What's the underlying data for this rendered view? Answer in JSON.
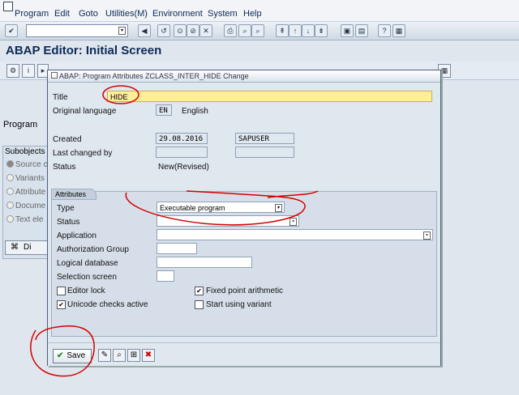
{
  "menubar": {
    "items": [
      "Program",
      "Edit",
      "Goto",
      "Utilities(M)",
      "Environment",
      "System",
      "Help"
    ]
  },
  "app": {
    "title": "ABAP Editor: Initial Screen"
  },
  "background": {
    "program_label": "Program",
    "subobjects_label": "Subobjects",
    "subobject_items": [
      "Source c",
      "Variants",
      "Attribute",
      "Docume",
      "Text ele"
    ],
    "display_button": "Di"
  },
  "dialog": {
    "title": "ABAP: Program Attributes ZCLASS_INTER_HIDE Change",
    "title_label": "Title",
    "title_value": "HIDE",
    "orig_lang_label": "Original language",
    "orig_lang_code": "EN",
    "orig_lang_name": "English",
    "created_label": "Created",
    "created_date": "29.08.2016",
    "created_user": "SAPUSER",
    "last_changed_label": "Last changed by",
    "status_label": "Status",
    "status_value": "New(Revised)",
    "attributes": {
      "group_label": "Attributes",
      "type_label": "Type",
      "type_value": "Executable program",
      "status_label": "Status",
      "application_label": "Application",
      "auth_group_label": "Authorization Group",
      "logical_db_label": "Logical database",
      "selection_screen_label": "Selection screen",
      "editor_lock_label": "Editor lock",
      "editor_lock_checked": false,
      "fixed_point_label": "Fixed point arithmetic",
      "fixed_point_checked": true,
      "unicode_label": "Unicode checks active",
      "unicode_checked": true,
      "start_variant_label": "Start using variant",
      "start_variant_checked": false
    },
    "footer": {
      "save_label": "Save"
    }
  },
  "colors": {
    "annotation_red": "#d40000",
    "title_field_yellow": "#ffee99",
    "brand_blue": "#0d2a57"
  }
}
